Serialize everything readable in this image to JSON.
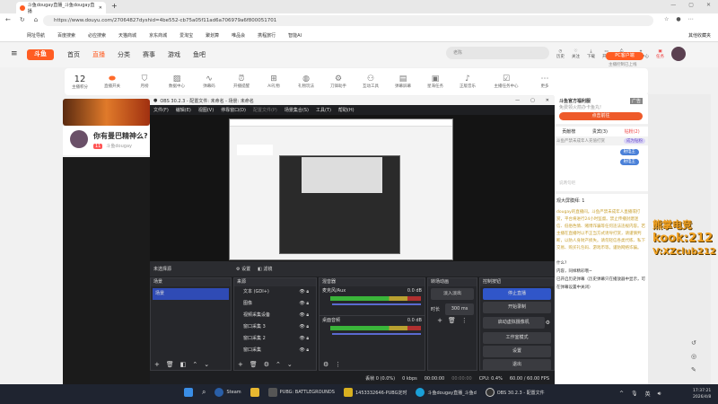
{
  "browser": {
    "tab_title": "斗鱼dougay直播_斗鱼dougay直播",
    "url": "https://www.douyu.com/27064827dyshid=4be552-cb75a05f11ad6a706979a6f800051701",
    "bookmarks": [
      "网址导航",
      "百度搜索",
      "必应搜索",
      "天猫商城",
      "京东商城",
      "爱淘宝",
      "聚划算",
      "唯品会",
      "携程旅行",
      "智能AI"
    ],
    "other_bookmarks": "其他收藏夹"
  },
  "douyu": {
    "logo": "斗鱼",
    "nav": [
      "首页",
      "直播",
      "分类",
      "赛事",
      "游戏",
      "鱼吧"
    ],
    "search_placeholder": "老陈",
    "header_icons": [
      "历史",
      "关注",
      "下载",
      "开播",
      "消息",
      "创作中心",
      "任务"
    ],
    "tools_score": "12",
    "tools_score_label": "主播积分",
    "tools": [
      "直播开关",
      "月榜",
      "数据中心",
      "弹幕码",
      "开播提醒",
      "AI礼物",
      "礼物玩法",
      "刀锋助手",
      "互动工具",
      "弹幕屏幕",
      "星海任务",
      "正版音乐",
      "主播任务中心",
      "更多"
    ],
    "pc_client": "PC客户端",
    "pc_sub": "主播控制已上线",
    "room_title": "你有曼巴精神么?",
    "room_level": "11",
    "room_owner": "斗鱼dougay",
    "side": {
      "ad_title": "斗鱼官方福利服",
      "ad_sub": "免费领火箭办卡鱼丸!",
      "ad_badge": "广告",
      "ad_btn": "点击前往",
      "tabs": [
        "贡献榜",
        "贵宾(3)",
        "钻粉(2)"
      ],
      "notice": "斗鱼严禁未成年人充值打赏",
      "become_fan": "成为钻粉",
      "users": [
        "射电王",
        "射电王"
      ],
      "input_hint": "说两句吧",
      "rank": "观大屏膜拜: 1",
      "warning": "dougay的直播间。斗鱼严禁未成年人直播或打赏，平台将进行24小时监督。禁止传播封建迷信、低俗色情、赌博诈骗等任何违法违规内容。若主播在直播时以不正当方式诱导打赏，请谨慎判断，以防人身财产损失。请勿轻信各类代练、私下交易、购买礼包码、游戏币等，谨防网络诈骗。",
      "chat": [
        "什么?",
        "内容，同样精彩哦~",
        "已开启历史弹幕（历史弹幕只在播放器中显示，可在弹幕设置中关闭）"
      ]
    },
    "watermark": [
      "熊掌电竞",
      "kook:212",
      "V:XZclub212"
    ]
  },
  "obs": {
    "title": "OBS 30.2.3 - 配置文件: 未命名 - 场景: 未命名",
    "menu": [
      "文件(F)",
      "编辑(E)",
      "视图(V)",
      "停靠窗口(D)",
      "配置文件(P)",
      "场景集合(S)",
      "工具(T)",
      "帮助(H)"
    ],
    "no_source": "未选择源",
    "settings_btn": "设置",
    "filters_btn": "滤镜",
    "docks": {
      "scenes": "场景",
      "sources": "来源",
      "mixer": "混音器",
      "transitions": "转场动画",
      "controls": "控制按钮"
    },
    "scene_items": [
      "场景"
    ],
    "source_items": [
      "文本 (GDI+)",
      "图像",
      "视频采集设备",
      "窗口采集 3",
      "窗口采集 2",
      "窗口采集"
    ],
    "mixer": [
      {
        "name": "麦克风/Aux",
        "db": "0.0 dB"
      },
      {
        "name": "桌面音频",
        "db": "0.0 dB"
      }
    ],
    "transition": "淡入淡出",
    "duration_label": "时长",
    "duration": "300 ms",
    "controls": [
      "停止直播",
      "开始录制",
      "启动虚拟摄像机",
      "工作室模式",
      "设置",
      "退出"
    ],
    "status": [
      "丢帧 0 (0.0%)",
      "0 kbps",
      "00:00:00",
      "00:00:00",
      "CPU: 0.4%",
      "60.00 / 60.00 FPS"
    ]
  },
  "taskbar": {
    "apps": [
      "Steam",
      "PUBG: BATTLEGROUNDS",
      "1453332646-PUBG定时",
      "斗鱼dougay直播_斗鱼d",
      "OBS 30.2.3 - 配置文件"
    ],
    "time": "17:37:21",
    "date": "2026/4/8"
  }
}
